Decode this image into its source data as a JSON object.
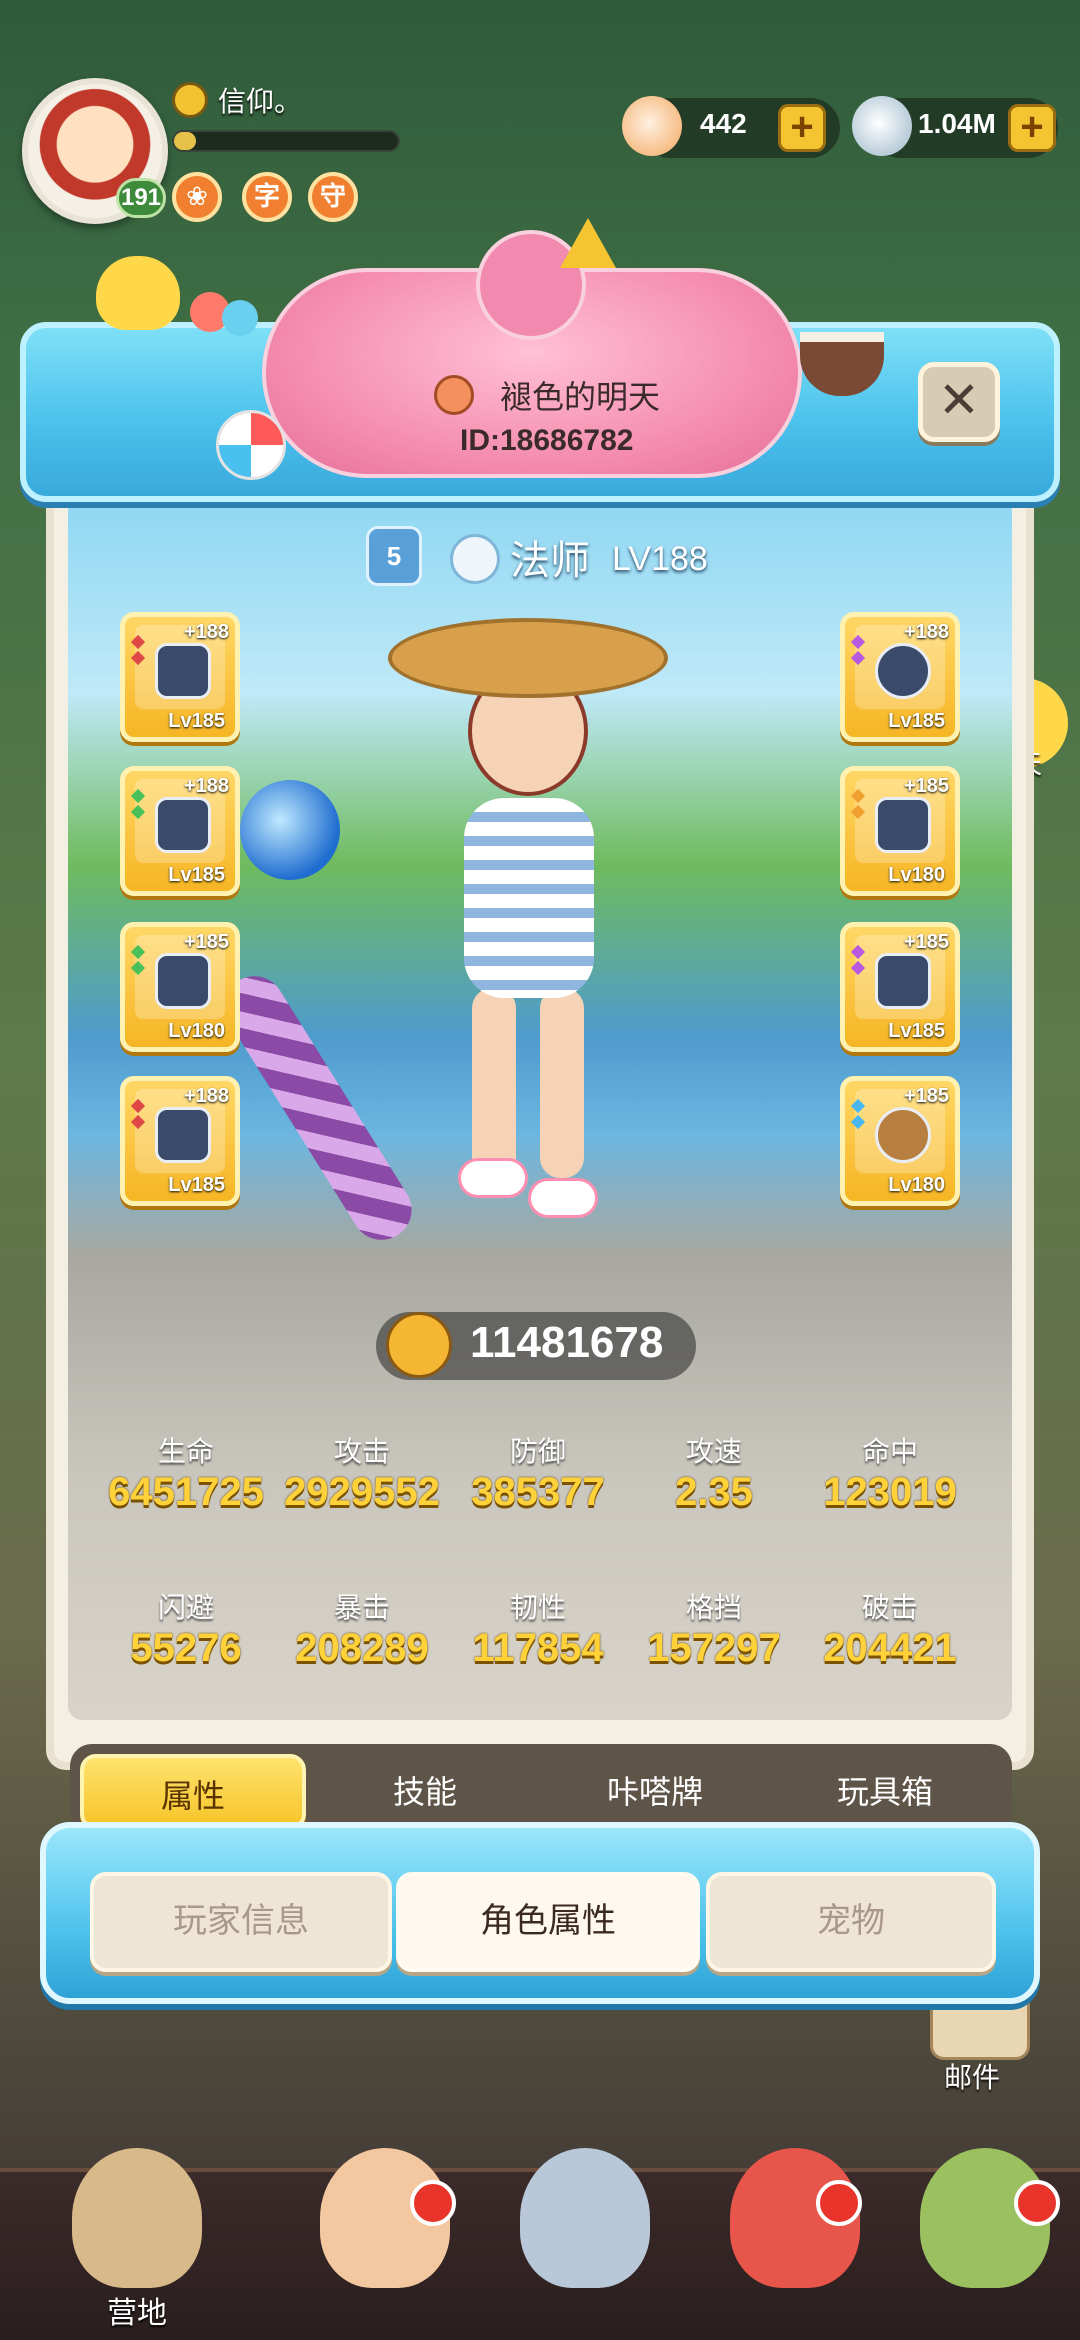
{
  "hud": {
    "player_name": "信仰。",
    "level": "191",
    "badges": [
      "❀",
      "字",
      "守"
    ],
    "resources": [
      {
        "icon": "shell-icon",
        "value": "442",
        "plus": "+"
      },
      {
        "icon": "clam-icon",
        "value": "1.04M",
        "plus": "+"
      }
    ],
    "exp_fraction": 0.1
  },
  "side": {
    "chat_label": "聊天",
    "mail_label": "邮件"
  },
  "profile": {
    "name": "褪色的明天",
    "id": "ID:18686782",
    "close_symbol": "✕",
    "rank": "5",
    "class_name": "法师",
    "class_level": "LV188"
  },
  "equipment": {
    "left": [
      {
        "plus": "+188",
        "lv": "Lv185"
      },
      {
        "plus": "+188",
        "lv": "Lv185"
      },
      {
        "plus": "+185",
        "lv": "Lv180"
      },
      {
        "plus": "+188",
        "lv": "Lv185"
      }
    ],
    "right": [
      {
        "plus": "+188",
        "lv": "Lv185"
      },
      {
        "plus": "+185",
        "lv": "Lv180"
      },
      {
        "plus": "+185",
        "lv": "Lv185"
      },
      {
        "plus": "+185",
        "lv": "Lv180"
      }
    ]
  },
  "power": "11481678",
  "stats": [
    {
      "label": "生命",
      "value": "6451725"
    },
    {
      "label": "攻击",
      "value": "2929552"
    },
    {
      "label": "防御",
      "value": "385377"
    },
    {
      "label": "攻速",
      "value": "2.35"
    },
    {
      "label": "命中",
      "value": "123019"
    },
    {
      "label": "闪避",
      "value": "55276"
    },
    {
      "label": "暴击",
      "value": "208289"
    },
    {
      "label": "韧性",
      "value": "117854"
    },
    {
      "label": "格挡",
      "value": "157297"
    },
    {
      "label": "破击",
      "value": "204421"
    }
  ],
  "subtabs": [
    "属性",
    "技能",
    "咔嗒牌",
    "玩具箱"
  ],
  "main_tabs": [
    "玩家信息",
    "角色属性",
    "宠物"
  ],
  "nav": [
    {
      "label": "营地"
    }
  ],
  "colors": {
    "accent_gold": "#f6c428",
    "stat_value": "#ffd23a",
    "frame_blue": "#4cc2ec",
    "badge_red": "#e8342a"
  }
}
